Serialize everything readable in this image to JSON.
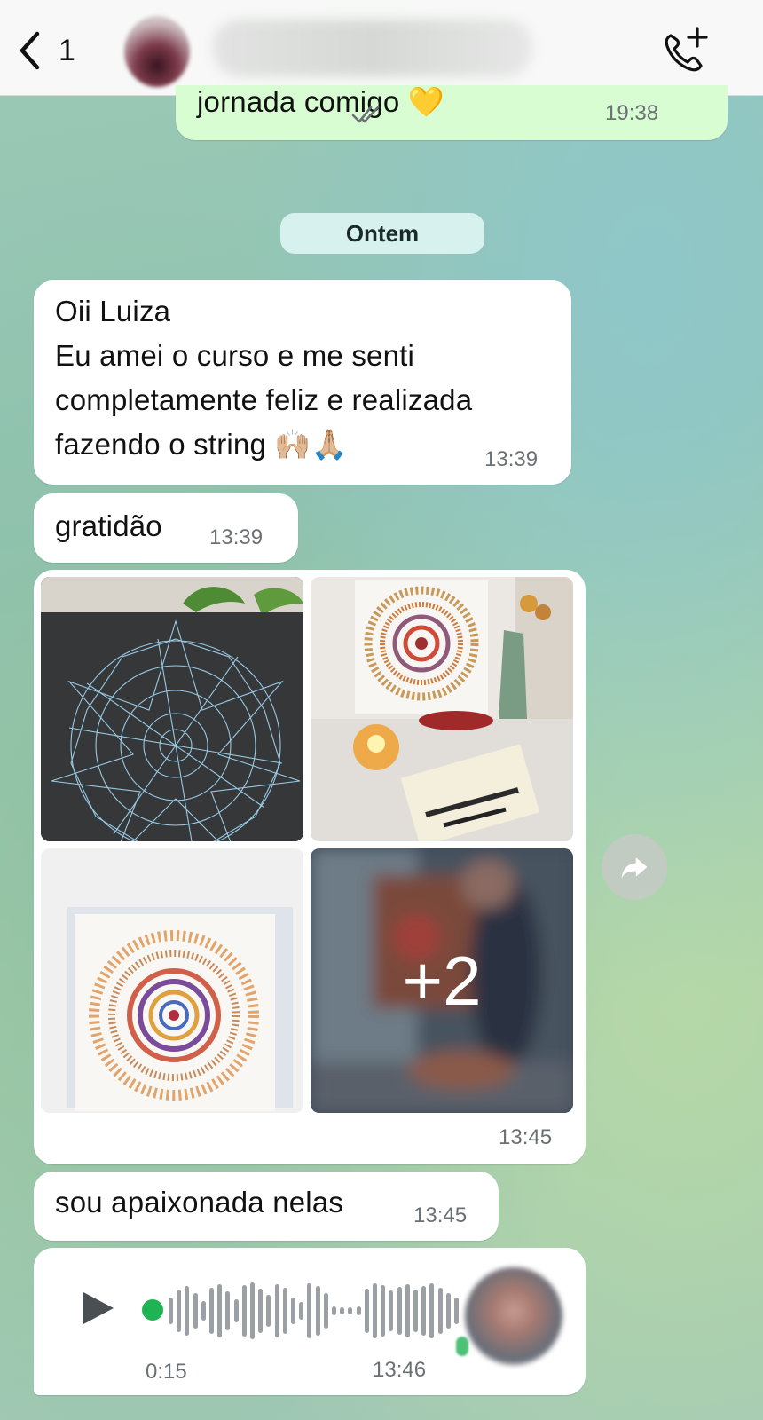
{
  "header": {
    "back_count": "1",
    "contact_name": "",
    "icons": {
      "back": "chevron-left-icon",
      "call": "add-call-icon"
    }
  },
  "prev_message": {
    "text": "jornada comigo 💛",
    "time": "19:38",
    "status_icon": "double-check-icon"
  },
  "date_separator": "Ontem",
  "messages": [
    {
      "lines": [
        "Oii Luiza",
        "Eu amei o curso e me senti",
        "completamente feliz e realizada",
        "fazendo o string 🙌🏼🙏🏼"
      ],
      "time": "13:39"
    },
    {
      "text": "gratidão",
      "time": "13:39"
    },
    {
      "album_more": "+2",
      "time": "13:45"
    },
    {
      "text": "sou apaixonada nelas",
      "time": "13:45"
    },
    {
      "voice_duration": "0:15",
      "time": "13:46"
    }
  ],
  "colors": {
    "incoming": "#ffffff",
    "outgoing": "#d9fdd3",
    "date_pill": "#d6f1ee",
    "voice_dot": "#1fb453"
  }
}
